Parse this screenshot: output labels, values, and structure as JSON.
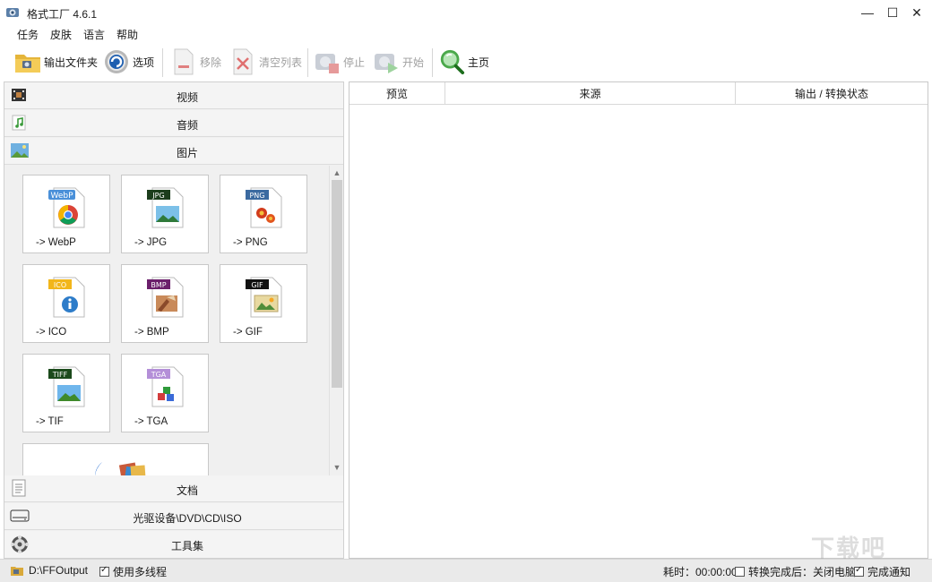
{
  "window": {
    "title": "格式工厂 4.6.1",
    "minimize": "—",
    "maximize": "☐",
    "close": "✕"
  },
  "menu": [
    "任务",
    "皮肤",
    "语言",
    "帮助"
  ],
  "toolbar": {
    "output_folder": "输出文件夹",
    "options": "选项",
    "remove": "移除",
    "clear_list": "清空列表",
    "stop": "停止",
    "start": "开始",
    "home": "主页"
  },
  "categories": {
    "video": "视频",
    "audio": "音频",
    "image": "图片",
    "document": "文档",
    "optical": "光驱设备\\DVD\\CD\\ISO",
    "tools": "工具集"
  },
  "image_formats": [
    {
      "label": "-> WebP",
      "badge": "WebP",
      "badge_color": "#4a90d9"
    },
    {
      "label": "-> JPG",
      "badge": "JPG",
      "badge_color": "#1c3d1c"
    },
    {
      "label": "-> PNG",
      "badge": "PNG",
      "badge_color": "#3b6aa0"
    },
    {
      "label": "-> ICO",
      "badge": "ICO",
      "badge_color": "#f2b61a"
    },
    {
      "label": "-> BMP",
      "badge": "BMP",
      "badge_color": "#6b1f6b"
    },
    {
      "label": "-> GIF",
      "badge": "GIF",
      "badge_color": "#111111"
    },
    {
      "label": "-> TIF",
      "badge": "TIFF",
      "badge_color": "#1b4a1b"
    },
    {
      "label": "-> TGA",
      "badge": "TGA",
      "badge_color": "#b48fd8"
    }
  ],
  "table": {
    "columns": [
      "预览",
      "来源",
      "输出 / 转换状态"
    ]
  },
  "status": {
    "output_path": "D:\\FFOutput",
    "multithread": "使用多线程",
    "elapsed": "耗时：00:00:00",
    "after_convert": "转换完成后：关闭电脑",
    "notify": "完成通知"
  },
  "watermark": "下载吧"
}
